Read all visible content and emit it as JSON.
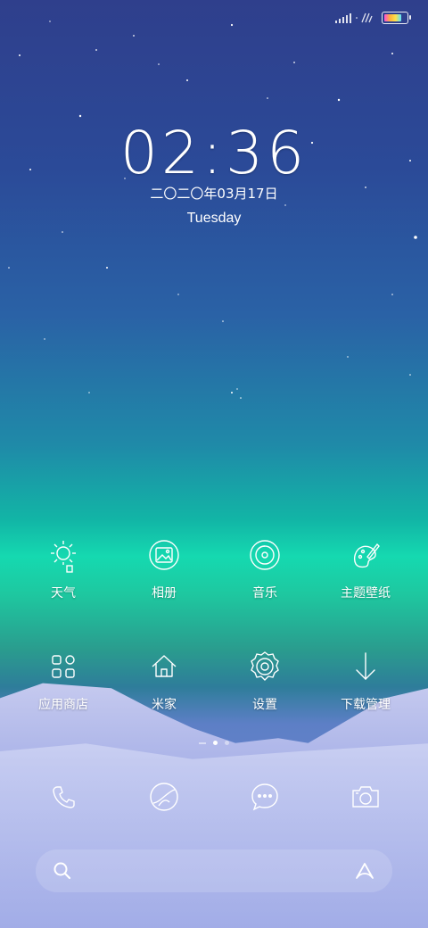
{
  "lockscreen": {
    "time": "02:36",
    "date": "二〇二〇年03月17日",
    "weekday": "Tuesday"
  },
  "status_bar": {
    "battery_level": 0.85,
    "icons": [
      "signal-icon",
      "no-sim-icon",
      "battery-icon"
    ]
  },
  "apps": [
    {
      "label": "天气",
      "icon": "weather-sun-icon"
    },
    {
      "label": "相册",
      "icon": "gallery-icon"
    },
    {
      "label": "音乐",
      "icon": "music-disc-icon"
    },
    {
      "label": "主题壁纸",
      "icon": "theme-brush-icon"
    },
    {
      "label": "应用商店",
      "icon": "app-store-grid-icon"
    },
    {
      "label": "米家",
      "icon": "home-icon"
    },
    {
      "label": "设置",
      "icon": "settings-gear-icon"
    },
    {
      "label": "下载管理",
      "icon": "download-arrow-icon"
    }
  ],
  "page_indicator": {
    "pages": 2,
    "current": 1
  },
  "dock": [
    {
      "icon": "phone-icon"
    },
    {
      "icon": "browser-icon"
    },
    {
      "icon": "messages-icon"
    },
    {
      "icon": "camera-icon"
    }
  ],
  "search_bar": {
    "left_icon": "search-icon",
    "right_icon": "assistant-icon"
  }
}
